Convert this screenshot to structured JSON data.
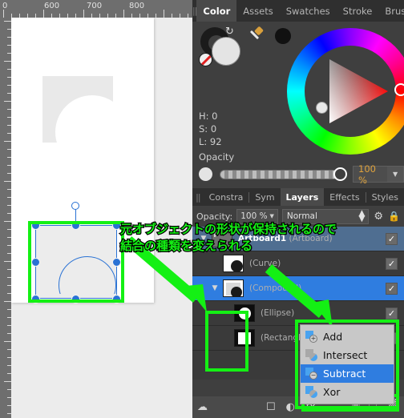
{
  "canvas": {
    "ruler_labels": [
      "0",
      "600",
      "700",
      "800"
    ],
    "shape_name": "compound-shape"
  },
  "color_panel": {
    "tabs": [
      {
        "label": "Color",
        "active": true
      },
      {
        "label": "Assets",
        "active": false
      },
      {
        "label": "Swatches",
        "active": false
      },
      {
        "label": "Stroke",
        "active": false
      },
      {
        "label": "Brushes",
        "active": false
      }
    ],
    "menu_icon": "hamburger-icon",
    "hsl": {
      "h_label": "H: 0",
      "s_label": "S: 0",
      "l_label": "L: 92"
    },
    "opacity": {
      "label": "Opacity",
      "value": "100 %"
    },
    "wheel_icon": "color-wheel",
    "eyedropper_icon": "eyedropper-icon"
  },
  "layers_panel": {
    "tabs": [
      {
        "label": "Constra",
        "active": false
      },
      {
        "label": "Sym",
        "active": false
      },
      {
        "label": "Layers",
        "active": true
      },
      {
        "label": "Effects",
        "active": false
      },
      {
        "label": "Styles",
        "active": false
      }
    ],
    "toolbar": {
      "opacity_label": "Opacity:",
      "opacity_value": "100 %",
      "blend_mode": "Normal",
      "gear_icon": "gear-icon",
      "lock_icon": "lock-icon"
    },
    "rows": [
      {
        "name": "Artboard1",
        "type": "(Artboard)",
        "selected": false,
        "artboard": true,
        "checked": true,
        "indent": 0,
        "twirl": true
      },
      {
        "name": "",
        "type": "(Curve)",
        "selected": false,
        "artboard": false,
        "checked": true,
        "indent": 1,
        "twirl": false
      },
      {
        "name": "",
        "type": "(Compound)",
        "selected": true,
        "artboard": false,
        "checked": true,
        "indent": 1,
        "twirl": true
      },
      {
        "name": "",
        "type": "(Ellipse)",
        "selected": false,
        "artboard": false,
        "checked": true,
        "indent": 2,
        "twirl": false
      },
      {
        "name": "",
        "type": "(Rectangle)",
        "selected": false,
        "artboard": false,
        "checked": true,
        "indent": 2,
        "twirl": false
      }
    ]
  },
  "context_menu": {
    "items": [
      {
        "label": "Add",
        "active": false,
        "icon": "boolean-add-icon"
      },
      {
        "label": "Intersect",
        "active": false,
        "icon": "boolean-intersect-icon"
      },
      {
        "label": "Subtract",
        "active": true,
        "icon": "boolean-subtract-icon"
      },
      {
        "label": "Xor",
        "active": false,
        "icon": "boolean-xor-icon"
      }
    ]
  },
  "annotation": {
    "line1": "元オブジェクトの形状が保持されるので",
    "line2": "結合の種類を変えられる",
    "color": "#14f014"
  },
  "bottom_bar": {
    "icons": [
      "layer-effects-icon",
      "mask-icon",
      "adjustment-icon",
      "fx-icon",
      "new-layer-icon",
      "duplicate-icon",
      "delete-icon"
    ]
  },
  "colors": {
    "accent_blue": "#2f7de0",
    "highlight_green": "#14f014",
    "panel_bg": "#3f3f3f",
    "value_orange": "#e0a33c"
  }
}
